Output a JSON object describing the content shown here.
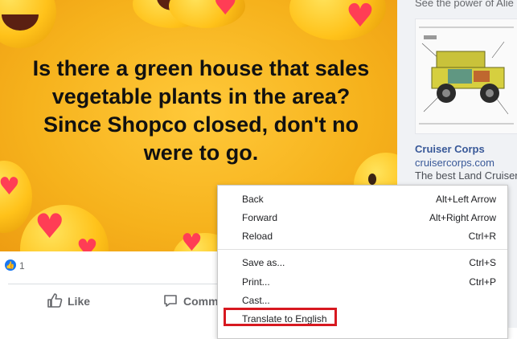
{
  "post": {
    "text": "Is there a green house that sales vegetable plants in the area? Since Shopco closed, don't no were to go.",
    "reaction_count": "1",
    "like_label": "Like",
    "comment_label": "Comme"
  },
  "sidebar": {
    "ad_top_text": "See the power of Alie",
    "ad_title": "Cruiser Corps",
    "ad_url": "cruisercorps.com",
    "ad_description": "The best Land Cruiser"
  },
  "context_menu": {
    "items": [
      {
        "label": "Back",
        "shortcut": "Alt+Left Arrow"
      },
      {
        "label": "Forward",
        "shortcut": "Alt+Right Arrow"
      },
      {
        "label": "Reload",
        "shortcut": "Ctrl+R"
      },
      {
        "label": "Save as...",
        "shortcut": "Ctrl+S"
      },
      {
        "label": "Print...",
        "shortcut": "Ctrl+P"
      },
      {
        "label": "Cast...",
        "shortcut": ""
      },
      {
        "label": "Translate to English",
        "shortcut": ""
      }
    ]
  },
  "colors": {
    "highlight": "#d71920",
    "link": "#385898",
    "facebook_blue": "#1877f2"
  }
}
